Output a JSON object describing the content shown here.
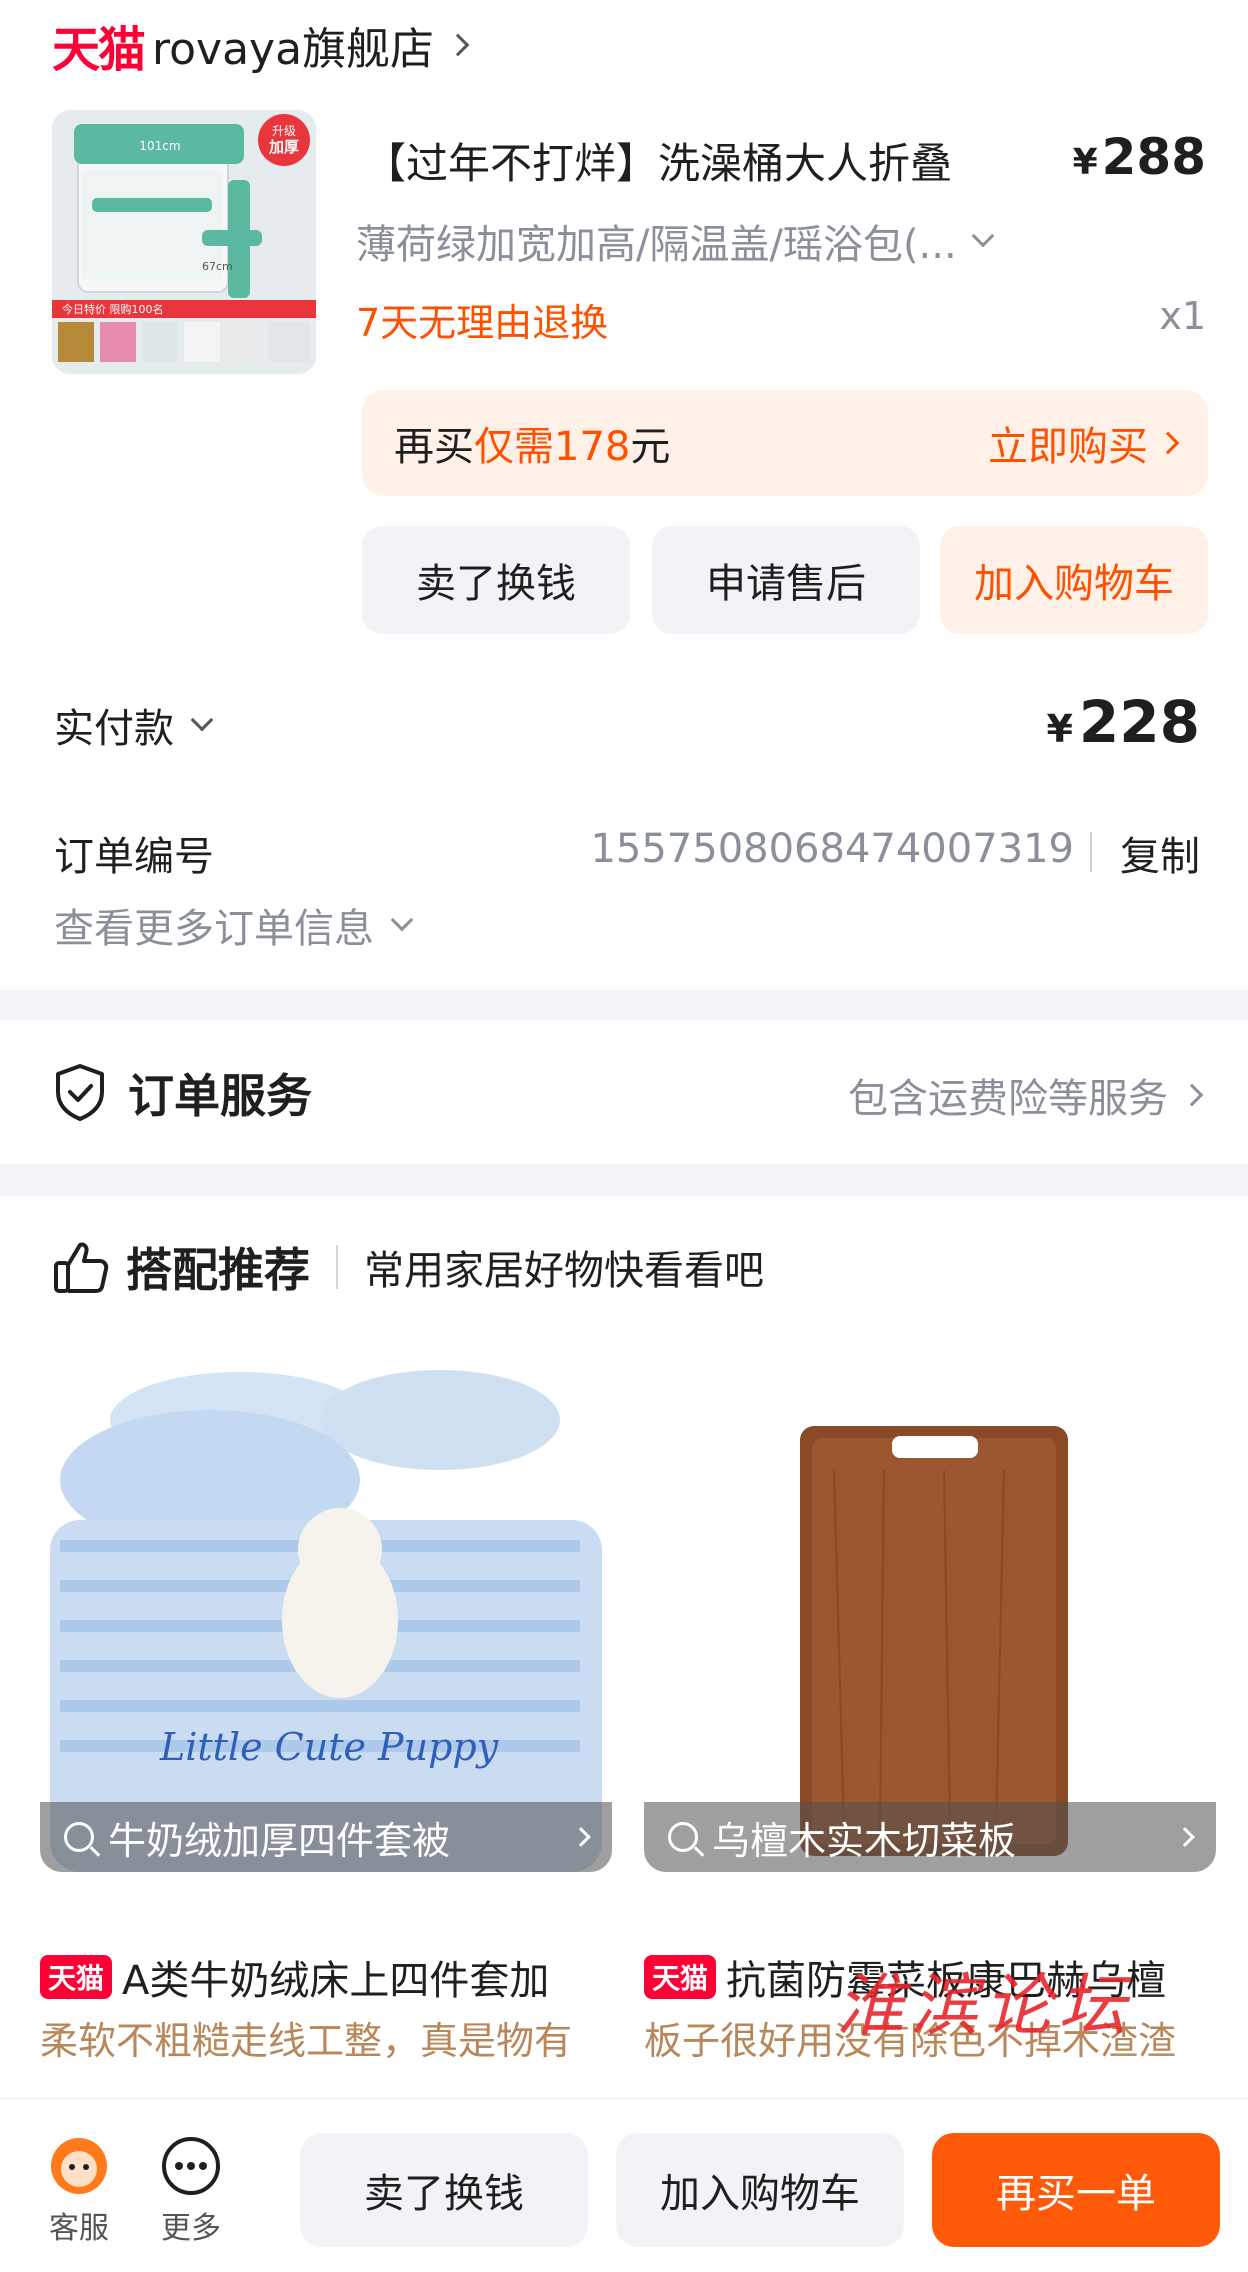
{
  "colors": {
    "brand_red": "#ff0036",
    "accent_orange": "#ff5000",
    "text_muted": "#8a8f99",
    "band_gray": "#f3f4f7"
  },
  "shop": {
    "logo_text": "天猫",
    "name": "rovaya旗舰店",
    "icon": "chevron-right-icon"
  },
  "product": {
    "title": "【过年不打烊】洗澡桶大人折叠",
    "price_symbol": "¥",
    "price": "288",
    "spec": "薄荷绿加宽加高/隔温盖/瑶浴包(...",
    "return_policy": "7天无理由退换",
    "quantity": "x1",
    "thumb_badge_top": "升级",
    "thumb_badge_bottom": "加厚",
    "thumb_promo": "今日特价 限购100名"
  },
  "rebuy": {
    "prefix": "再买",
    "highlight": "仅需178",
    "suffix": "元",
    "cta": "立即购买"
  },
  "actions": [
    "卖了换钱",
    "申请售后",
    "加入购物车"
  ],
  "payment": {
    "label": "实付款",
    "symbol": "¥",
    "amount": "228"
  },
  "order": {
    "label": "订单编号",
    "number": "1557508068474007319",
    "copy": "复制",
    "more": "查看更多订单信息"
  },
  "service": {
    "title": "订单服务",
    "link": "包含运费险等服务",
    "icon": "shield-check-icon"
  },
  "recommend": {
    "title": "搭配推荐",
    "subtitle": "常用家居好物快看看吧",
    "icon": "thumbs-up-icon",
    "cards": [
      {
        "search": "牛奶绒加厚四件套被",
        "tag": "天猫",
        "title": "A类牛奶绒床上四件套加",
        "review": "柔软不粗糙走线工整，真是物有",
        "image_text": "Little Cute Puppy"
      },
      {
        "search": "乌檀木实木切菜板",
        "tag": "天猫",
        "title": "抗菌防霉菜板康巴赫乌檀",
        "review": "板子很好用没有除色不掉木渣渣"
      }
    ],
    "watermark": "淮滨论坛"
  },
  "bottom_bar": {
    "service_label": "客服",
    "more_label": "更多",
    "btn_sell": "卖了换钱",
    "btn_cart": "加入购物车",
    "btn_rebuy": "再买一单"
  }
}
